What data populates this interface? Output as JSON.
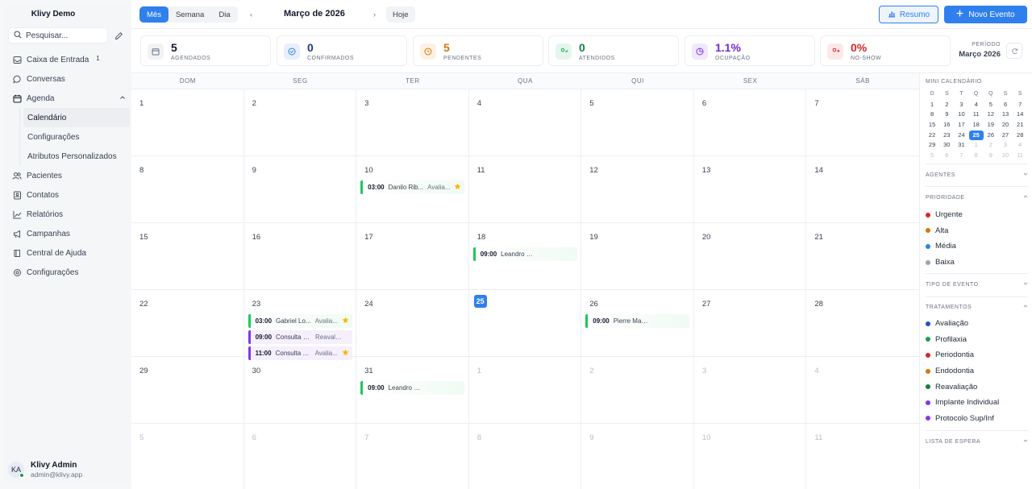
{
  "sidebar": {
    "brand": "Klivy Demo",
    "search_placeholder": "Pesquisar...",
    "items": [
      {
        "label": "Caixa de Entrada",
        "badge": "1",
        "icon": "inbox-icon"
      },
      {
        "label": "Conversas",
        "icon": "chat-icon"
      },
      {
        "label": "Agenda",
        "icon": "calendar-icon"
      }
    ],
    "agenda_sub": [
      {
        "label": "Calendário",
        "active": true
      },
      {
        "label": "Configurações"
      },
      {
        "label": "Atributos Personalizados"
      }
    ],
    "items2": [
      {
        "label": "Pacientes",
        "icon": "users-icon"
      },
      {
        "label": "Contatos",
        "icon": "contacts-icon"
      },
      {
        "label": "Relatórios",
        "icon": "chart-icon"
      },
      {
        "label": "Campanhas",
        "icon": "megaphone-icon"
      },
      {
        "label": "Central de Ajuda",
        "icon": "book-icon"
      },
      {
        "label": "Configurações",
        "icon": "gear-icon"
      }
    ],
    "user": {
      "initials": "KA",
      "name": "Klivy Admin",
      "email": "admin@klivy.app"
    }
  },
  "toolbar": {
    "views": [
      "Mês",
      "Semana",
      "Dia"
    ],
    "active_view": "Mês",
    "prev": "‹",
    "next": "›",
    "month_title": "Março de 2026",
    "today_label": "Hoje",
    "resumo_label": "Resumo",
    "new_label": "Novo Evento"
  },
  "stats": [
    {
      "value": "5",
      "label": "AGENDADOS",
      "color": "#111827",
      "icon": "calendar-icon",
      "icon_color": "#6b7280",
      "icon_bg": "#f1f3f5"
    },
    {
      "value": "0",
      "label": "CONFIRMADOS",
      "color": "#1e3a8a",
      "icon": "check-circle-icon",
      "icon_color": "#2f80ed",
      "icon_bg": "#e8f0fc"
    },
    {
      "value": "5",
      "label": "PENDENTES",
      "color": "#d97706",
      "icon": "clock-icon",
      "icon_color": "#d97706",
      "icon_bg": "#fdf1e3"
    },
    {
      "value": "0",
      "label": "ATENDIDOS",
      "color": "#15803d",
      "icon": "user-check-icon",
      "icon_color": "#16a34a",
      "icon_bg": "#e7f6ec"
    },
    {
      "value": "1.1%",
      "label": "OCUPAÇÃO",
      "color": "#6d28d9",
      "icon": "pie-icon",
      "icon_color": "#7c3aed",
      "icon_bg": "#f0e9fd"
    },
    {
      "value": "0%",
      "label": "NO-SHOW",
      "color": "#dc2626",
      "icon": "user-x-icon",
      "icon_color": "#dc2626",
      "icon_bg": "#fde8e8"
    }
  ],
  "period": {
    "label": "PERÍODO",
    "value": "Março 2026"
  },
  "calendar": {
    "weekdays": [
      "DOM",
      "SEG",
      "TER",
      "QUA",
      "QUI",
      "SEX",
      "SÁB"
    ],
    "weeks": [
      [
        {
          "d": "1"
        },
        {
          "d": "2"
        },
        {
          "d": "3"
        },
        {
          "d": "4"
        },
        {
          "d": "5"
        },
        {
          "d": "6"
        },
        {
          "d": "7"
        }
      ],
      [
        {
          "d": "8"
        },
        {
          "d": "9"
        },
        {
          "d": "10",
          "events": [
            {
              "time": "03:00",
              "name": "Danilo Rib...",
              "kind": "Avalia...",
              "color": "green",
              "star": true
            }
          ]
        },
        {
          "d": "11"
        },
        {
          "d": "12"
        },
        {
          "d": "13"
        },
        {
          "d": "14"
        }
      ],
      [
        {
          "d": "15"
        },
        {
          "d": "16"
        },
        {
          "d": "17"
        },
        {
          "d": "18",
          "events": [
            {
              "time": "09:00",
              "name": "Leandro Lopes",
              "kind": "",
              "color": "green"
            }
          ]
        },
        {
          "d": "19"
        },
        {
          "d": "20"
        },
        {
          "d": "21"
        }
      ],
      [
        {
          "d": "22"
        },
        {
          "d": "23",
          "events": [
            {
              "time": "03:00",
              "name": "Gabriel Lo...",
              "kind": "Avalia...",
              "color": "green",
              "star": true
            },
            {
              "time": "09:00",
              "name": "Consulta Dr. ...",
              "kind": "Reavalia...",
              "color": "purple"
            },
            {
              "time": "11:00",
              "name": "Consulta Dr. ...",
              "kind": "Avalia...",
              "color": "purple",
              "star": true
            }
          ]
        },
        {
          "d": "24"
        },
        {
          "d": "25",
          "today": true
        },
        {
          "d": "26",
          "events": [
            {
              "time": "09:00",
              "name": "Pierre Maciel",
              "kind": "",
              "color": "green"
            }
          ]
        },
        {
          "d": "27"
        },
        {
          "d": "28"
        }
      ],
      [
        {
          "d": "29"
        },
        {
          "d": "30"
        },
        {
          "d": "31",
          "events": [
            {
              "time": "09:00",
              "name": "Leandro Lopes",
              "kind": "",
              "color": "green"
            }
          ]
        },
        {
          "d": "1",
          "other": true
        },
        {
          "d": "2",
          "other": true
        },
        {
          "d": "3",
          "other": true
        },
        {
          "d": "4",
          "other": true
        }
      ],
      [
        {
          "d": "5",
          "other": true
        },
        {
          "d": "6",
          "other": true
        },
        {
          "d": "7",
          "other": true
        },
        {
          "d": "8",
          "other": true
        },
        {
          "d": "9",
          "other": true
        },
        {
          "d": "10",
          "other": true
        },
        {
          "d": "11",
          "other": true
        }
      ]
    ]
  },
  "mini_calendar": {
    "title": "MINI CALENDÁRIO",
    "headers": [
      "D",
      "S",
      "T",
      "Q",
      "Q",
      "S",
      "S"
    ],
    "weeks": [
      [
        {
          "d": "1"
        },
        {
          "d": "2"
        },
        {
          "d": "3"
        },
        {
          "d": "4"
        },
        {
          "d": "5"
        },
        {
          "d": "6"
        },
        {
          "d": "7"
        }
      ],
      [
        {
          "d": "8"
        },
        {
          "d": "9"
        },
        {
          "d": "10"
        },
        {
          "d": "11"
        },
        {
          "d": "12"
        },
        {
          "d": "13"
        },
        {
          "d": "14"
        }
      ],
      [
        {
          "d": "15"
        },
        {
          "d": "16"
        },
        {
          "d": "17"
        },
        {
          "d": "18"
        },
        {
          "d": "19"
        },
        {
          "d": "20"
        },
        {
          "d": "21"
        }
      ],
      [
        {
          "d": "22"
        },
        {
          "d": "23"
        },
        {
          "d": "24"
        },
        {
          "d": "25",
          "sel": true
        },
        {
          "d": "26"
        },
        {
          "d": "27"
        },
        {
          "d": "28"
        }
      ],
      [
        {
          "d": "29"
        },
        {
          "d": "30"
        },
        {
          "d": "31"
        },
        {
          "d": "1",
          "other": true
        },
        {
          "d": "2",
          "other": true
        },
        {
          "d": "3",
          "other": true
        },
        {
          "d": "4",
          "other": true
        }
      ],
      [
        {
          "d": "5",
          "other": true
        },
        {
          "d": "6",
          "other": true
        },
        {
          "d": "7",
          "other": true
        },
        {
          "d": "8",
          "other": true
        },
        {
          "d": "9",
          "other": true
        },
        {
          "d": "10",
          "other": true
        },
        {
          "d": "11",
          "other": true
        }
      ]
    ]
  },
  "filters": {
    "agentes": "AGENTES",
    "prioridade": "PRIORIDADE",
    "prioridades": [
      {
        "label": "Urgente",
        "color": "#dc2626"
      },
      {
        "label": "Alta",
        "color": "#d97706"
      },
      {
        "label": "Média",
        "color": "#2f80ed"
      },
      {
        "label": "Baixa",
        "color": "#9ca3af"
      }
    ],
    "tipo": "TIPO DE EVENTO",
    "tratamentos_label": "TRATAMENTOS",
    "tratamentos": [
      {
        "label": "Avaliação",
        "color": "#1d4ed8"
      },
      {
        "label": "Profilaxia",
        "color": "#16a34a"
      },
      {
        "label": "Periodontia",
        "color": "#dc2626"
      },
      {
        "label": "Endodontia",
        "color": "#d97706"
      },
      {
        "label": "Reavaliação",
        "color": "#15803d"
      },
      {
        "label": "Implante Individual",
        "color": "#7c3aed"
      },
      {
        "label": "Protocolo Sup/Inf",
        "color": "#9333ea"
      }
    ],
    "espera": "LISTA DE ESPERA"
  }
}
